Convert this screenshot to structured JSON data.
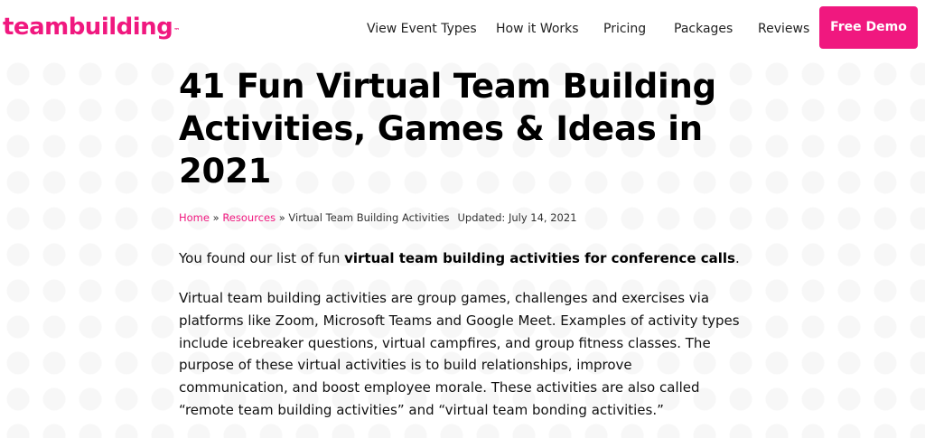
{
  "header": {
    "logo_text": "teambuilding",
    "logo_tm": "™",
    "nav": [
      "View Event Types",
      "How it Works",
      "Pricing",
      "Packages",
      "Reviews"
    ],
    "cta_label": "Free Demo"
  },
  "article": {
    "title": "41 Fun Virtual Team Building Activities, Games & Ideas in 2021",
    "breadcrumb": {
      "home": "Home",
      "sep1": " » ",
      "resources": "Resources",
      "sep2": " » ",
      "current": "Virtual Team Building Activities",
      "updated": "Updated: July 14, 2021"
    },
    "intro_prefix": "You found our list of fun ",
    "intro_bold": "virtual team building activities for conference calls",
    "intro_suffix": ".",
    "paragraph": "Virtual team building activities are group games, challenges and exercises via platforms like Zoom, Microsoft Teams and Google Meet. Examples of activity types include icebreaker questions, virtual campfires, and group fitness classes. The purpose of these virtual activities is to build relationships, improve communication, and boost employee morale. These activities are also called “remote team building activities” and “virtual team bonding activities.”"
  },
  "colors": {
    "brand": "#f0187f",
    "text": "#111111",
    "background": "#ffffff",
    "dot": "#f7f7f7"
  },
  "icons": []
}
